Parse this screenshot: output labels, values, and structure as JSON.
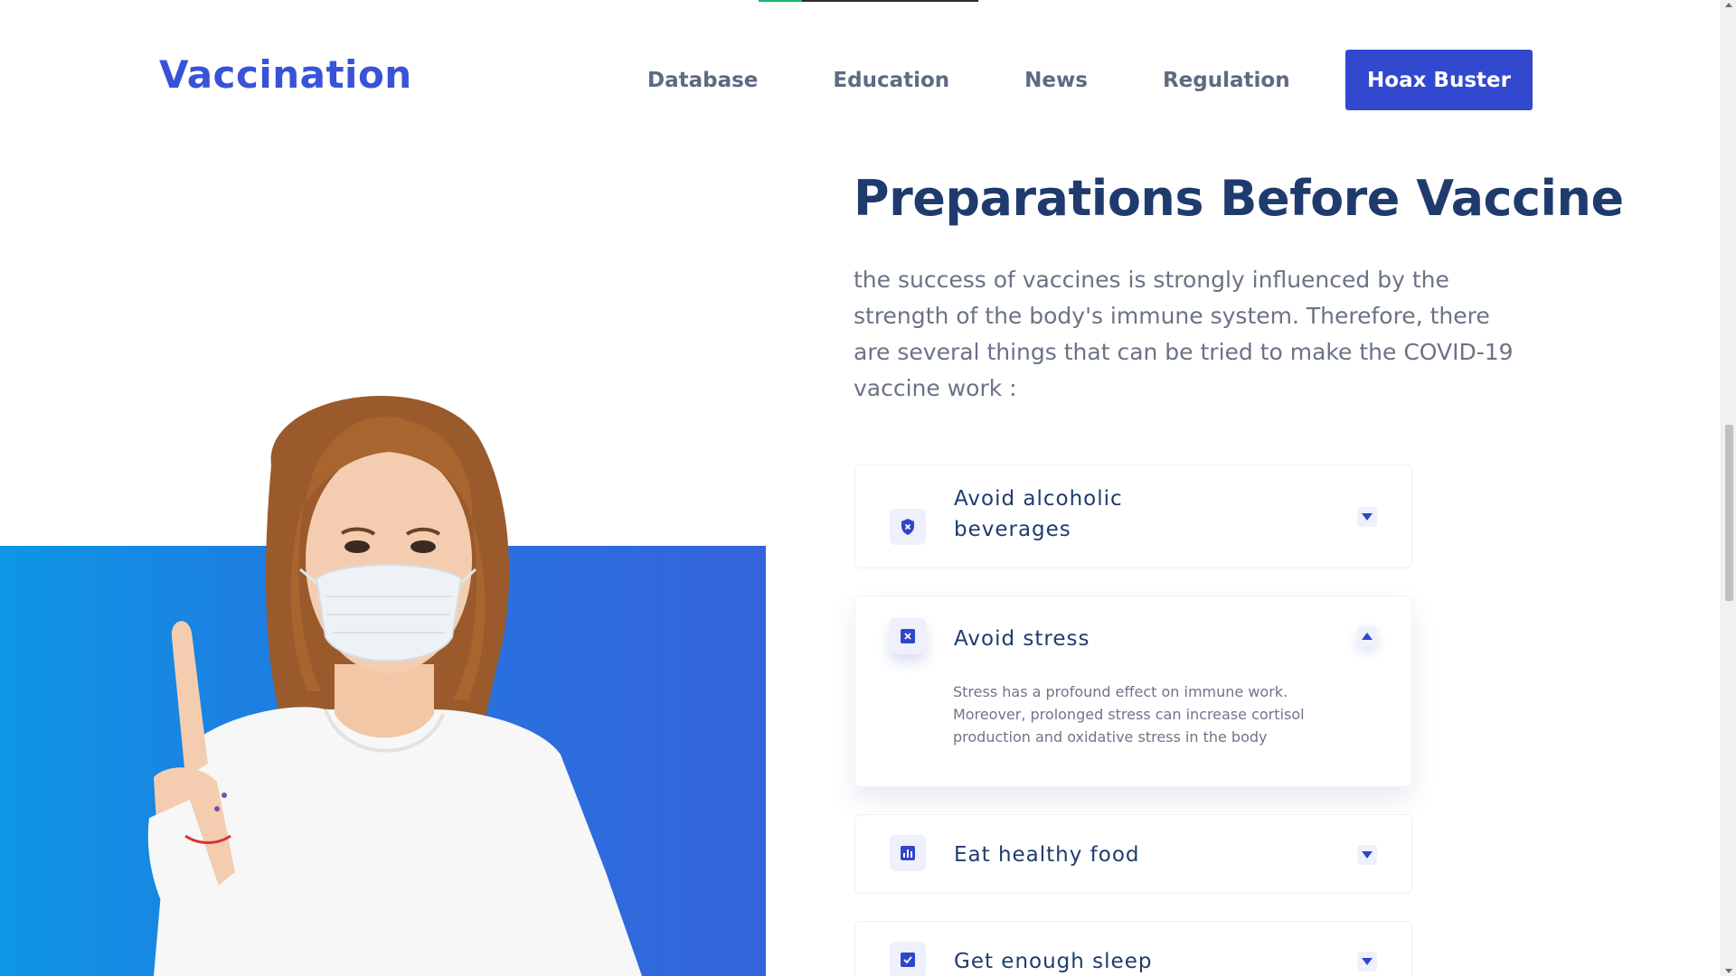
{
  "brand": {
    "name": "Vaccination",
    "accent": "#3148cf"
  },
  "nav": {
    "items": [
      {
        "label": "Database"
      },
      {
        "label": "Education"
      },
      {
        "label": "News"
      },
      {
        "label": "Regulation"
      }
    ],
    "cta_label": "Hoax Buster"
  },
  "section": {
    "title": "Preparations Before Vaccine",
    "intro": "the success of vaccines is strongly influenced by the strength of the body's immune system. Therefore, there are several things that can be tried to make the COVID-19 vaccine work :"
  },
  "accordion": [
    {
      "title": "Avoid alcoholic beverages",
      "icon": "shield-x-icon",
      "expanded": false
    },
    {
      "title": "Avoid stress",
      "icon": "x-square-icon",
      "expanded": true,
      "body": "Stress has a profound effect on immune work. Moreover, prolonged stress can increase cortisol production and oxidative stress in the body"
    },
    {
      "title": "Eat healthy food",
      "icon": "bar-chart-icon",
      "expanded": false
    },
    {
      "title": "Get enough sleep",
      "icon": "check-square-icon",
      "expanded": false
    }
  ]
}
